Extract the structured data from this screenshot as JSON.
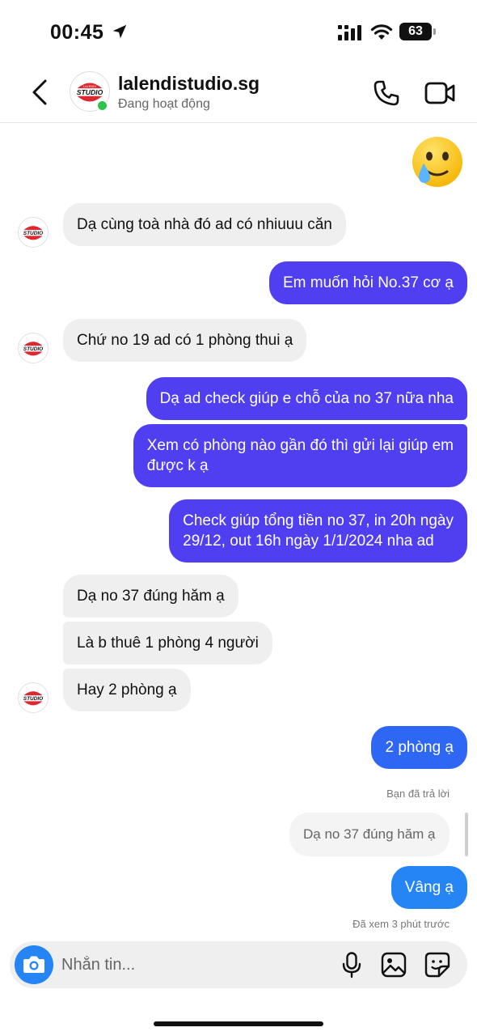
{
  "status_bar": {
    "time": "00:45",
    "battery": "63"
  },
  "header": {
    "name": "lalendistudio.sg",
    "status": "Đang hoạt động"
  },
  "avatar": {
    "logo_text": "STUDIO",
    "logo_small": "LALENDI"
  },
  "messages": {
    "m1": "Dạ cùng toà nhà đó ad có nhiuuu căn",
    "m2": "Em muốn hỏi No.37 cơ ạ",
    "m3": "Chứ no 19 ad có 1 phòng thui ạ",
    "m4": "Dạ ad check giúp e chỗ của no 37 nữa nha",
    "m5_line1": "Xem có phòng nào gần đó thì gửi lại giúp em",
    "m5_line2": "được k ạ",
    "m6_line1": "Check giúp tổng tiền no 37,  in 20h ngày",
    "m6_line2": "29/12, out 16h ngày 1/1/2024 nha ad",
    "m7": "Dạ no 37 đúng hăm ạ",
    "m8": "Là b thuê 1 phòng 4 người",
    "m9": "Hay 2 phòng ạ",
    "m10": "2 phòng ạ",
    "m11": "Vâng ạ"
  },
  "reply": {
    "label": "Bạn đã trả lời",
    "quoted": "Dạ no 37 đúng hăm ạ"
  },
  "seen": "Đã xem 3 phút trước",
  "composer": {
    "placeholder": "Nhắn tin..."
  },
  "colors": {
    "outgoing_bubble": "#4f3ff0",
    "incoming_bubble": "#efefef",
    "camera_button": "#2585f5",
    "online_dot": "#2bc34a",
    "logo_red": "#e0262e"
  }
}
